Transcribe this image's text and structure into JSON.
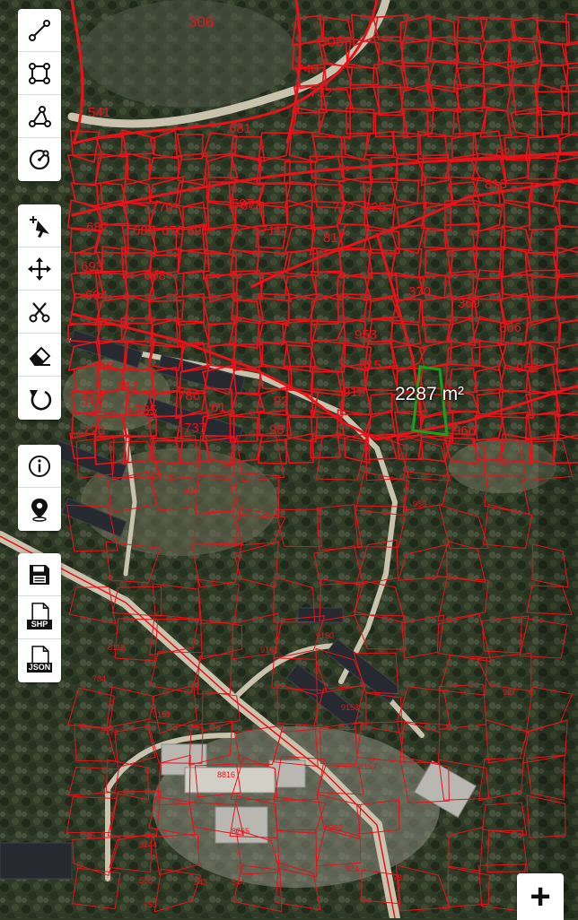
{
  "map": {
    "parcel_color": "#e8121a",
    "selected_color": "#19a01c",
    "measurement": {
      "value": "2287",
      "unit": "m²"
    },
    "parcel_labels_large": [
      "306",
      "306",
      "541",
      "740",
      "732",
      "681",
      "682",
      "597",
      "676",
      "678",
      "687",
      "695",
      "693",
      "694",
      "698",
      "770",
      "712",
      "711",
      "725",
      "817",
      "821",
      "813",
      "48",
      "311",
      "312",
      "735",
      "786",
      "61",
      "92",
      "98",
      "720",
      "737",
      "370",
      "369",
      "866",
      "963",
      "953",
      "915",
      "919",
      "966"
    ],
    "parcel_labels_small": [
      "85",
      "856",
      "9150",
      "9144",
      "9153",
      "9157",
      "8765",
      "8362",
      "8816",
      "824",
      "543",
      "544",
      "565",
      "753",
      "784",
      "782",
      "9173",
      "26",
      "9161",
      "9159",
      "8112",
      "938",
      "958",
      "927"
    ]
  },
  "toolbar": {
    "draw_group": [
      {
        "name": "draw-line-button",
        "icon": "line-icon"
      },
      {
        "name": "draw-rectangle-button",
        "icon": "rectangle-icon"
      },
      {
        "name": "draw-polygon-button",
        "icon": "polygon-icon"
      },
      {
        "name": "draw-circle-button",
        "icon": "circle-icon"
      }
    ],
    "edit_group": [
      {
        "name": "select-button",
        "icon": "cursor-icon"
      },
      {
        "name": "move-button",
        "icon": "move-icon"
      },
      {
        "name": "cut-button",
        "icon": "scissors-icon"
      },
      {
        "name": "erase-button",
        "icon": "eraser-icon"
      },
      {
        "name": "undo-button",
        "icon": "undo-icon"
      }
    ],
    "info_group": [
      {
        "name": "info-button",
        "icon": "info-icon"
      },
      {
        "name": "locate-button",
        "icon": "location-pin-icon"
      }
    ],
    "export_group": [
      {
        "name": "save-button",
        "icon": "floppy-icon"
      },
      {
        "name": "export-shp-button",
        "icon": "shp-file-icon",
        "label": "SHP"
      },
      {
        "name": "export-json-button",
        "icon": "json-file-icon",
        "label": "JSON"
      }
    ]
  },
  "zoom": {
    "in_label": "+"
  }
}
